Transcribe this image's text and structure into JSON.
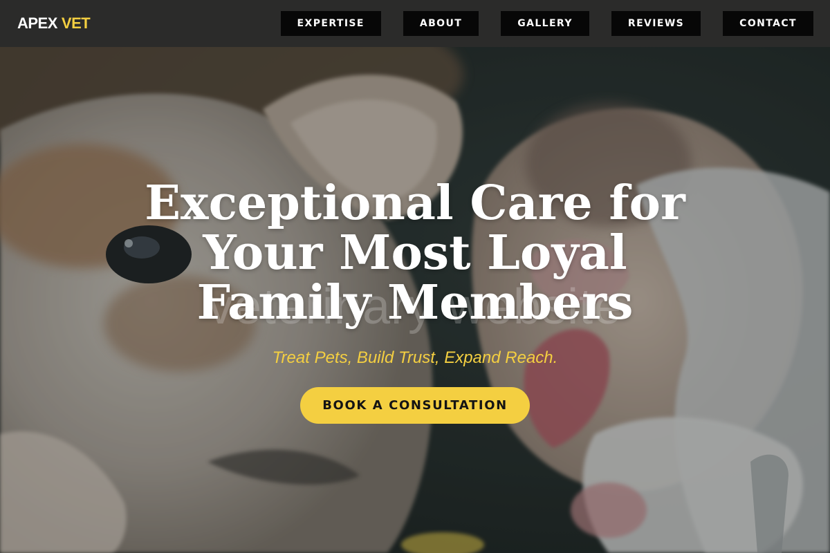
{
  "brand": {
    "name_part1": "APEX",
    "name_part2": "VET"
  },
  "nav": {
    "items": [
      {
        "label": "EXPERTISE"
      },
      {
        "label": "ABOUT"
      },
      {
        "label": "GALLERY"
      },
      {
        "label": "REVIEWS"
      },
      {
        "label": "CONTACT"
      }
    ]
  },
  "hero": {
    "watermark": "veterinary website",
    "headline": "Exceptional Care for Your Most Loyal Family Members",
    "tagline": "Treat Pets, Build Trust, Expand Reach.",
    "cta_label": "BOOK A CONSULTATION",
    "background_icon": "puppies-photo"
  },
  "colors": {
    "accent": "#f4cf41",
    "nav_bg": "#2b2b2a",
    "nav_button_bg": "#070707",
    "text": "#ffffff"
  }
}
